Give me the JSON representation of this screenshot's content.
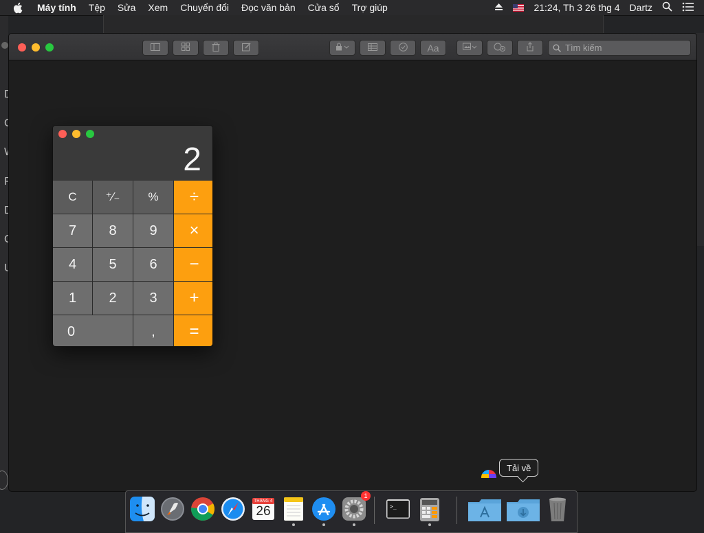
{
  "menubar": {
    "app_name": "Máy tính",
    "menus": [
      "Tệp",
      "Sửa",
      "Xem",
      "Chuyển đổi",
      "Đọc văn bản",
      "Cửa sổ",
      "Trợ giúp"
    ],
    "datetime": "21:24, Th 3 26 thg 4",
    "user": "Dartz",
    "icons": [
      "apple-icon",
      "eject-icon",
      "us-flag-icon",
      "spotlight-icon",
      "notification-center-icon"
    ]
  },
  "background_window_letters": [
    "D",
    "C",
    "W",
    "P",
    "D",
    "C",
    "U"
  ],
  "main_window": {
    "toolbar_icons": [
      "sidebar-icon",
      "grid-icon",
      "trash-icon",
      "compose-icon",
      "lock-icon",
      "table-icon",
      "checklist-icon",
      "format-icon",
      "media-icon",
      "collaborate-icon",
      "share-icon"
    ],
    "format_label": "Aa",
    "search_placeholder": "Tìm kiếm"
  },
  "calculator": {
    "display": "2",
    "rows": [
      [
        {
          "label": "C",
          "kind": "fn"
        },
        {
          "label": "⁺∕₋",
          "kind": "fn"
        },
        {
          "label": "%",
          "kind": "fn"
        },
        {
          "label": "÷",
          "kind": "op"
        }
      ],
      [
        {
          "label": "7",
          "kind": "num"
        },
        {
          "label": "8",
          "kind": "num"
        },
        {
          "label": "9",
          "kind": "num"
        },
        {
          "label": "×",
          "kind": "op"
        }
      ],
      [
        {
          "label": "4",
          "kind": "num"
        },
        {
          "label": "5",
          "kind": "num"
        },
        {
          "label": "6",
          "kind": "num"
        },
        {
          "label": "−",
          "kind": "op"
        }
      ],
      [
        {
          "label": "1",
          "kind": "num"
        },
        {
          "label": "2",
          "kind": "num"
        },
        {
          "label": "3",
          "kind": "num"
        },
        {
          "label": "+",
          "kind": "op"
        }
      ],
      [
        {
          "label": "0",
          "kind": "num"
        },
        {
          "label": ",",
          "kind": "num"
        },
        {
          "label": "=",
          "kind": "op"
        }
      ]
    ],
    "colors": {
      "operator": "#fd9f0f",
      "function_key": "#5c5c5c",
      "number_key": "#6e6e6e"
    }
  },
  "dock": {
    "tooltip": "Tải về",
    "apps": [
      "finder-icon",
      "launchpad-icon",
      "chrome-icon",
      "safari-icon",
      "calendar-icon",
      "notes-icon",
      "app-store-icon",
      "system-preferences-icon",
      "terminal-icon",
      "calculator-icon",
      "applications-folder-icon",
      "downloads-folder-icon",
      "trash-icon"
    ],
    "calendar_month": "THÁNG 4",
    "calendar_day": "26",
    "sys_prefs_badge": "1"
  }
}
